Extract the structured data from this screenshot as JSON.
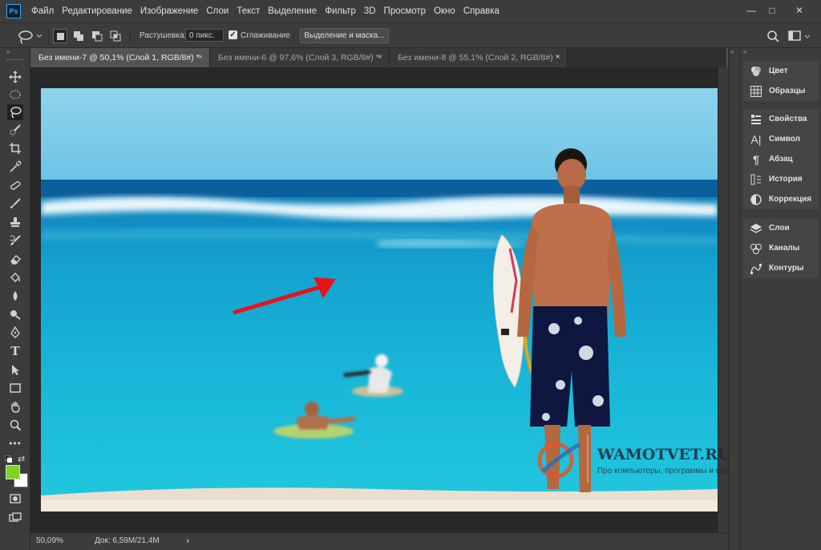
{
  "app": {
    "logo_text": "Ps"
  },
  "menu": {
    "items": [
      "Файл",
      "Редактирование",
      "Изображение",
      "Слои",
      "Текст",
      "Выделение",
      "Фильтр",
      "3D",
      "Просмотр",
      "Окно",
      "Справка"
    ]
  },
  "window_controls": {
    "minimize": "—",
    "maximize": "□",
    "close": "✕"
  },
  "options": {
    "feather_label": "Растушевка:",
    "feather_value": "0 пикс.",
    "antialias_checked": true,
    "antialias_label": "Сглаживание",
    "mask_button": "Выделение и маска..."
  },
  "tabs": [
    {
      "label": "Без имени-7 @ 50,1% (Слой 1, RGB/8#) *",
      "active": true
    },
    {
      "label": "Без имени-6 @ 97,6% (Слой 3, RGB/8#) *",
      "active": false
    },
    {
      "label": "Без имени-8 @ 55,1% (Слой 2, RGB/8#) *",
      "active": false
    }
  ],
  "tab_close": "×",
  "status": {
    "zoom": "50,09%",
    "doc": "Док: 6,59M/21,4M",
    "arrow": "›"
  },
  "colors": {
    "foreground": "#7ed321",
    "background": "#ffffff",
    "accent": "#31a8ff"
  },
  "panels": {
    "group1": [
      {
        "label": "Цвет",
        "icon": "color-wheel-icon"
      },
      {
        "label": "Образцы",
        "icon": "swatches-icon"
      }
    ],
    "group2": [
      {
        "label": "Свойства",
        "icon": "properties-icon"
      },
      {
        "label": "Символ",
        "icon": "character-icon"
      },
      {
        "label": "Абзац",
        "icon": "paragraph-icon"
      },
      {
        "label": "История",
        "icon": "history-icon"
      },
      {
        "label": "Коррекция",
        "icon": "adjustments-icon"
      }
    ],
    "group3": [
      {
        "label": "Слои",
        "icon": "layers-icon"
      },
      {
        "label": "Каналы",
        "icon": "channels-icon"
      },
      {
        "label": "Контуры",
        "icon": "paths-icon"
      }
    ]
  },
  "watermark": {
    "title": "WAMOTVET.RU",
    "subtitle": "Про компьютеры, программы и сайты"
  }
}
